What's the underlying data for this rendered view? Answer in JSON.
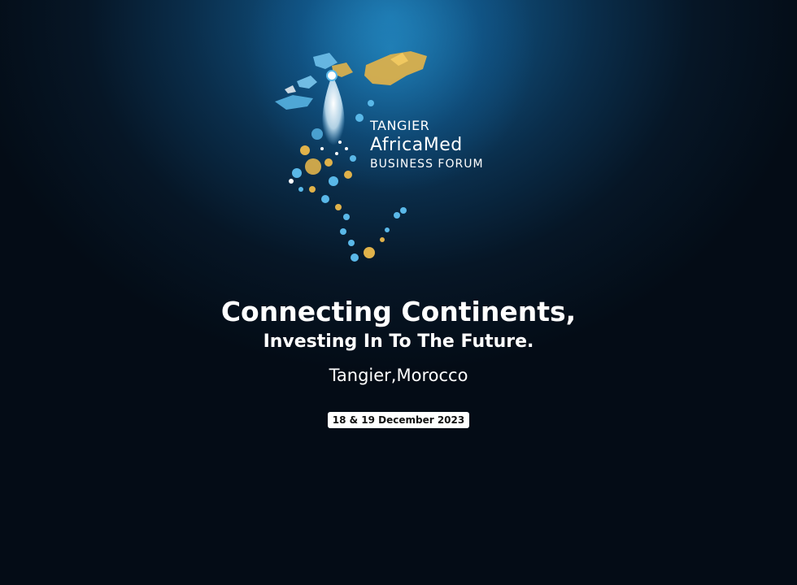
{
  "logo": {
    "line1": "TANGIER",
    "line2": "AfricaMed",
    "line3": "BUSINESS FORUM"
  },
  "headline": {
    "title": "Connecting Continents,",
    "subtitle": "Investing In To The Future.",
    "location": "Tangier,Morocco"
  },
  "event": {
    "date": "18 & 19 December 2023"
  },
  "colors": {
    "background_dark": "#040c16",
    "background_glow": "#1a6fa3",
    "logo_gold": "#e0b24a",
    "logo_blue": "#5ab8e8",
    "text": "#ffffff"
  }
}
